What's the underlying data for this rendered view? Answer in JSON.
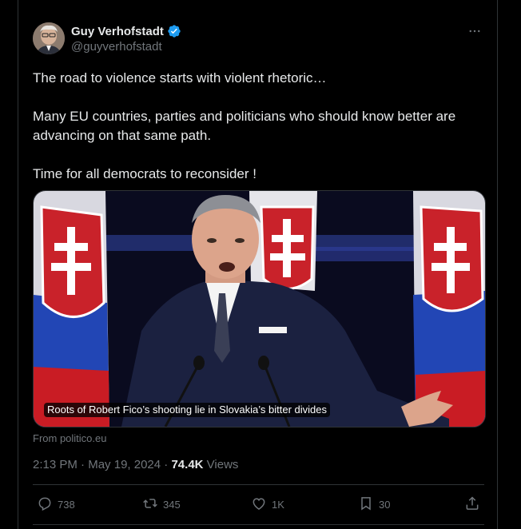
{
  "tweet": {
    "author_name": "Guy Verhofstadt",
    "author_handle": "@guyverhofstadt",
    "paragraphs": [
      "The road to violence starts with violent rhetoric…",
      "Many EU countries, parties and politicians who should know better are advancing on that same path.",
      "Time for all democrats to reconsider !"
    ],
    "card": {
      "caption": "Roots of Robert Fico’s shooting lie in Slovakia’s bitter divides",
      "source": "From politico.eu"
    },
    "meta": {
      "time": "2:13 PM",
      "separator1": " · ",
      "date": "May 19, 2024",
      "separator2": " · ",
      "views_count": "74.4K",
      "views_label": " Views"
    },
    "actions": {
      "replies": "738",
      "reposts": "345",
      "likes": "1K",
      "bookmarks": "30"
    }
  },
  "colors": {
    "background": "#000000",
    "text_primary": "#e7e9ea",
    "text_secondary": "#71767b",
    "verified_blue": "#1d9bf0",
    "border": "#2f3336"
  },
  "icons": [
    "more-icon",
    "verified-badge-icon",
    "reply-icon",
    "repost-icon",
    "like-icon",
    "bookmark-icon",
    "share-icon"
  ]
}
